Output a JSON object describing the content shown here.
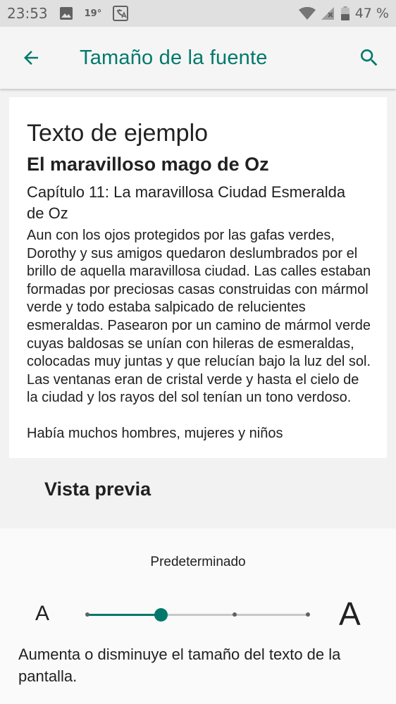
{
  "status_bar": {
    "time": "23:53",
    "temperature": "19°",
    "battery": "47 %",
    "icons": [
      "image-icon",
      "translate-icon",
      "wifi-icon",
      "signal-icon",
      "battery-icon"
    ]
  },
  "app_bar": {
    "title": "Tamaño de la fuente",
    "back_icon": "arrow-back-icon",
    "search_icon": "search-icon"
  },
  "preview": {
    "heading": "Texto de ejemplo",
    "book_title": "El maravilloso mago de Oz",
    "chapter": "Capítulo 11: La maravillosa Ciudad Esmeralda de Oz",
    "paragraphs": [
      "Aun con los ojos protegidos por las gafas verdes, Dorothy y sus amigos quedaron deslumbrados por el brillo de aquella maravillosa ciudad. Las calles estaban formadas por preciosas casas construidas con mármol verde y todo estaba salpicado de relucientes esmeraldas. Pasearon por un camino de mármol verde cuyas baldosas se unían con hileras de esmeraldas, colocadas muy juntas y que relucían bajo la luz del sol. Las ventanas eran de cristal verde y hasta el cielo de la ciudad y los rayos del sol tenían un tono verdoso.",
      "Había muchos hombres, mujeres y niños"
    ],
    "label": "Vista previa"
  },
  "font_size": {
    "current_label": "Predeterminado",
    "small_label": "A",
    "large_label": "A",
    "steps": 4,
    "selected_index": 1,
    "description": "Aumenta o disminuye el tamaño del texto de la pantalla."
  },
  "colors": {
    "accent": "#00796b",
    "status_bar_bg": "#e0e0e0",
    "app_bar_bg": "#f5f5f5",
    "card_bg": "#ffffff",
    "track": "#c8c8c8"
  }
}
